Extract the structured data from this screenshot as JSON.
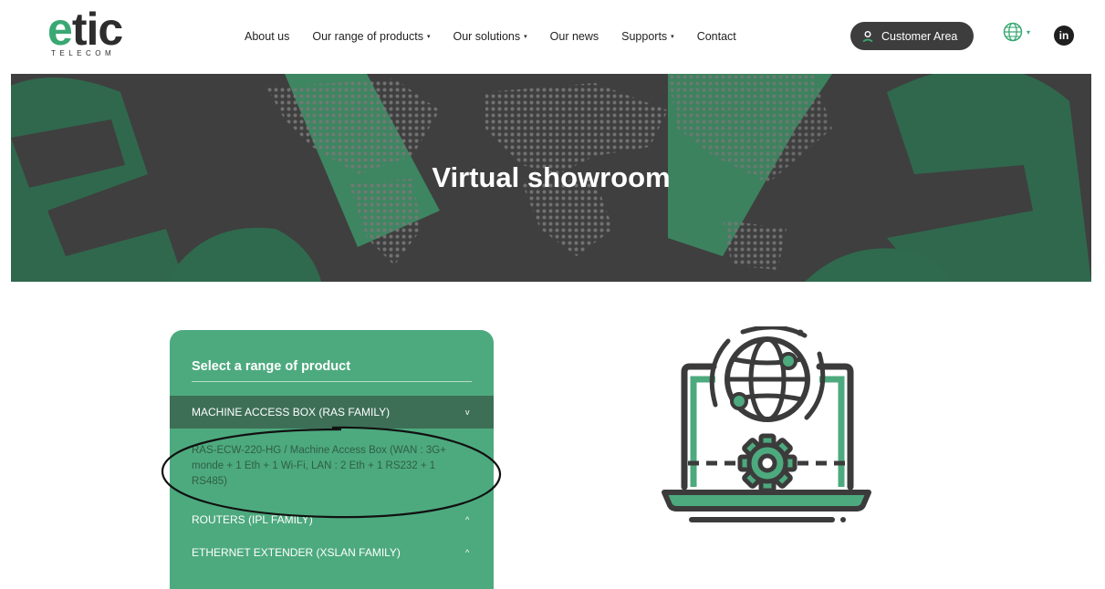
{
  "brand": {
    "name_prefix": "e",
    "name_suffix": "tic",
    "subtitle": "TELECOM"
  },
  "nav": {
    "items": [
      {
        "label": "About us",
        "has_caret": false
      },
      {
        "label": "Our range of products",
        "has_caret": true
      },
      {
        "label": "Our solutions",
        "has_caret": true
      },
      {
        "label": "Our news",
        "has_caret": false
      },
      {
        "label": "Supports",
        "has_caret": true
      },
      {
        "label": "Contact",
        "has_caret": false
      }
    ],
    "caret_glyph": "▾"
  },
  "customer_area": {
    "label": "Customer Area",
    "icon": "user-icon"
  },
  "language": {
    "icon": "globe-icon",
    "caret": "▾"
  },
  "social": {
    "linkedin": "in"
  },
  "banner": {
    "title": "Virtual showroom"
  },
  "panel": {
    "title": "Select a range of product",
    "ranges": [
      {
        "label": "MACHINE ACCESS BOX (RAS FAMILY)",
        "chevron": "v",
        "expanded": true
      },
      {
        "label": "ROUTERS (IPL FAMILY)",
        "chevron": "^",
        "expanded": false
      },
      {
        "label": "ETHERNET EXTENDER (XSLAN FAMILY)",
        "chevron": "^",
        "expanded": false
      }
    ],
    "subitem": "RAS-ECW-220-HG / Machine Access Box (WAN : 3G+ monde + 1 Eth + 1 Wi-Fi, LAN : 2 Eth + 1 RS232 + 1 RS485)"
  },
  "colors": {
    "brand_green": "#3aa873",
    "panel_green": "#4daa7e",
    "active_row": "#3d6f57",
    "banner_gray": "#3f3f3f",
    "dark": "#2d2d2d"
  },
  "illustration": {
    "icon": "laptop-globe-gear-icon"
  }
}
